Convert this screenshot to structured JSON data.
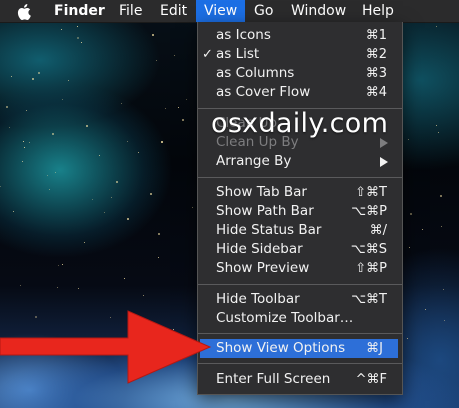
{
  "menubar": {
    "apple_icon": "apple-logo-icon",
    "items": [
      "Finder",
      "File",
      "Edit",
      "View",
      "Go",
      "Window",
      "Help"
    ],
    "active_menu": "View"
  },
  "menu": {
    "items": [
      {
        "label": "as Icons",
        "shortcut": "⌘1",
        "checked": false
      },
      {
        "label": "as List",
        "shortcut": "⌘2",
        "checked": true,
        "check_mark": "✓"
      },
      {
        "label": "as Columns",
        "shortcut": "⌘3",
        "checked": false
      },
      {
        "label": "as Cover Flow",
        "shortcut": "⌘4",
        "checked": false
      },
      {
        "label": "Clean Up",
        "shortcut": "",
        "disabled": true
      },
      {
        "label": "Clean Up By",
        "shortcut": "",
        "disabled": true
      },
      {
        "label": "Arrange By",
        "shortcut": "",
        "submenu": true
      },
      {
        "label": "Show Tab Bar",
        "shortcut": "⇧⌘T"
      },
      {
        "label": "Show Path Bar",
        "shortcut": "⌥⌘P"
      },
      {
        "label": "Hide Status Bar",
        "shortcut": "⌘/"
      },
      {
        "label": "Hide Sidebar",
        "shortcut": "⌥⌘S"
      },
      {
        "label": "Show Preview",
        "shortcut": "⇧⌘P"
      },
      {
        "label": "Hide Toolbar",
        "shortcut": "⌥⌘T"
      },
      {
        "label": "Customize Toolbar…",
        "shortcut": ""
      },
      {
        "label": "Show View Options",
        "shortcut": "⌘J",
        "highlighted": true
      },
      {
        "label": "Enter Full Screen",
        "shortcut": "^⌘F"
      }
    ]
  },
  "watermark": "osxdaily.com",
  "colors": {
    "menubar_bg": "#2b2b2c",
    "menu_bg": "#2e2e30",
    "highlight": "#2d6fd8",
    "arrow": "#e8261d"
  },
  "icons": {
    "submenu_arrow": "chevron-right-icon",
    "annotation": "red-arrow-icon"
  }
}
